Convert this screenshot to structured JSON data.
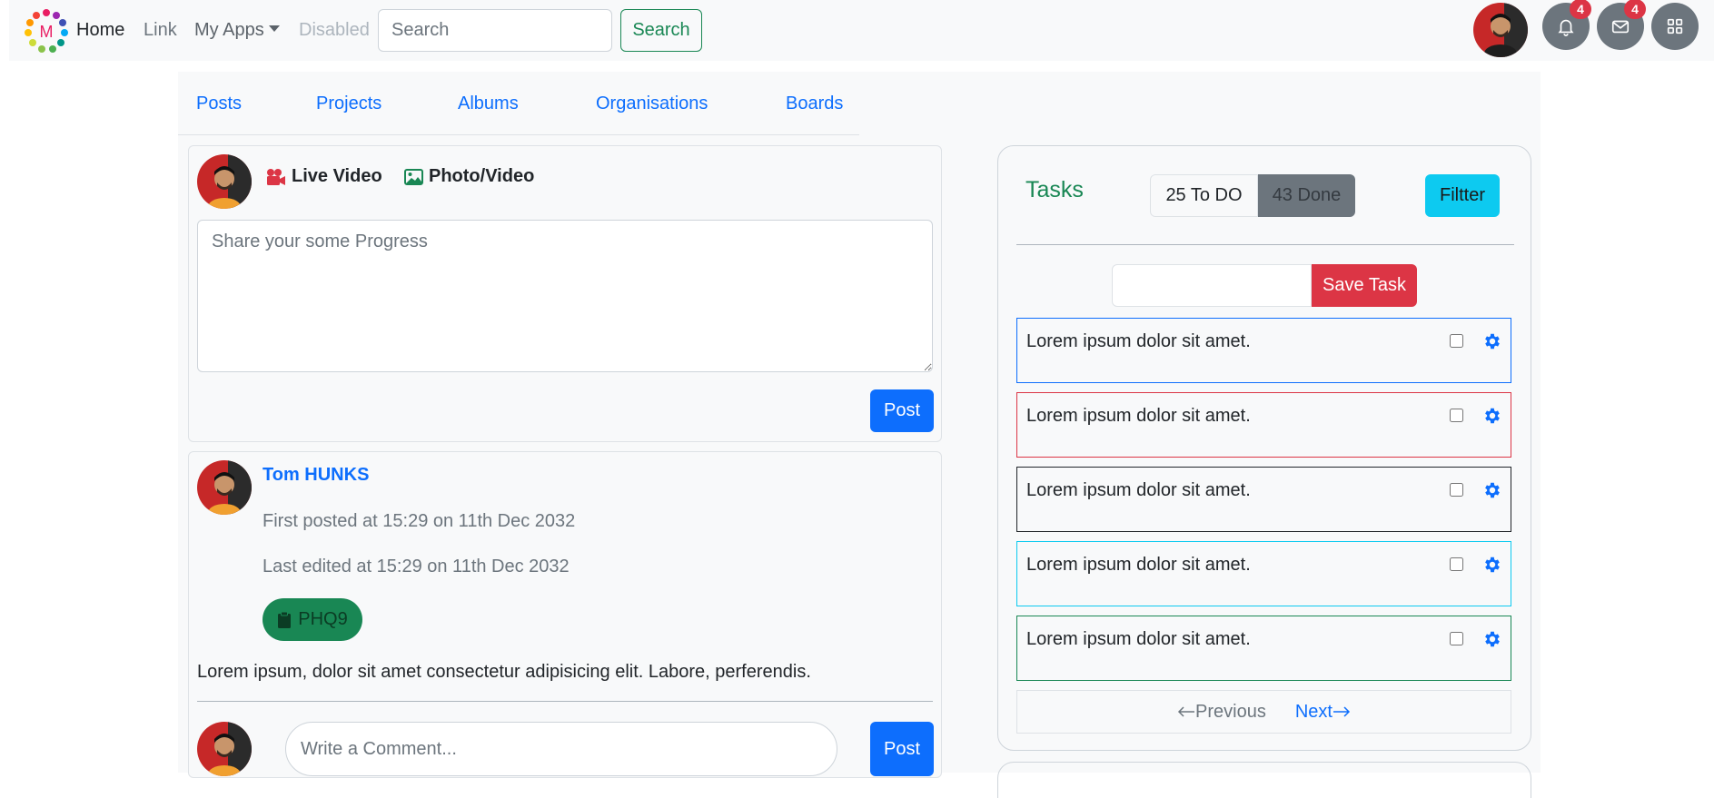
{
  "navbar": {
    "brand_letter": "M",
    "home": "Home",
    "link": "Link",
    "apps": "My Apps",
    "disabled": "Disabled",
    "search_placeholder": "Search",
    "search_button": "Search",
    "notifications_count": "4",
    "messages_count": "4"
  },
  "tabs": [
    "Posts",
    "Projects",
    "Albums",
    "Organisations",
    "Boards"
  ],
  "composer": {
    "live_video": "Live Video",
    "photo_video": "Photo/Video",
    "placeholder": "Share your some Progress",
    "post_button": "Post"
  },
  "post": {
    "author": "Tom HUNKS",
    "first_posted": "First posted at 15:29 on 11th Dec 2032",
    "last_edited": "Last edited at 15:29 on 11th Dec 2032",
    "tag": "PHQ9",
    "body": "Lorem ipsum, dolor sit amet consectetur adipisicing elit. Labore, perferendis.",
    "comment_placeholder": "Write a Comment...",
    "post_button": "Post"
  },
  "tasks": {
    "title": "Tasks",
    "todo_label": "25 To DO",
    "done_label": "43 Done",
    "filter_button": "Filtter",
    "save_button": "Save Task",
    "items": [
      {
        "text": "Lorem ipsum dolor sit amet.",
        "border_color": "#0d6efd"
      },
      {
        "text": "Lorem ipsum dolor sit amet.",
        "border_color": "#dc3545"
      },
      {
        "text": "Lorem ipsum dolor sit amet.",
        "border_color": "#212529"
      },
      {
        "text": "Lorem ipsum dolor sit amet.",
        "border_color": "#0dcaf0"
      },
      {
        "text": "Lorem ipsum dolor sit amet.",
        "border_color": "#198754"
      }
    ],
    "previous": "Previous",
    "next": "Next"
  },
  "colors": {
    "primary": "#0d6efd",
    "success": "#198754",
    "danger": "#dc3545",
    "info": "#0dcaf0",
    "secondary": "#6c757d"
  },
  "icons": [
    "brand-logo-icon",
    "caret-down-icon",
    "bell-icon",
    "envelope-icon",
    "grid-icon",
    "camera-video-icon",
    "image-icon",
    "clipboard-icon",
    "gear-icon",
    "arrow-left-icon",
    "arrow-right-icon"
  ]
}
